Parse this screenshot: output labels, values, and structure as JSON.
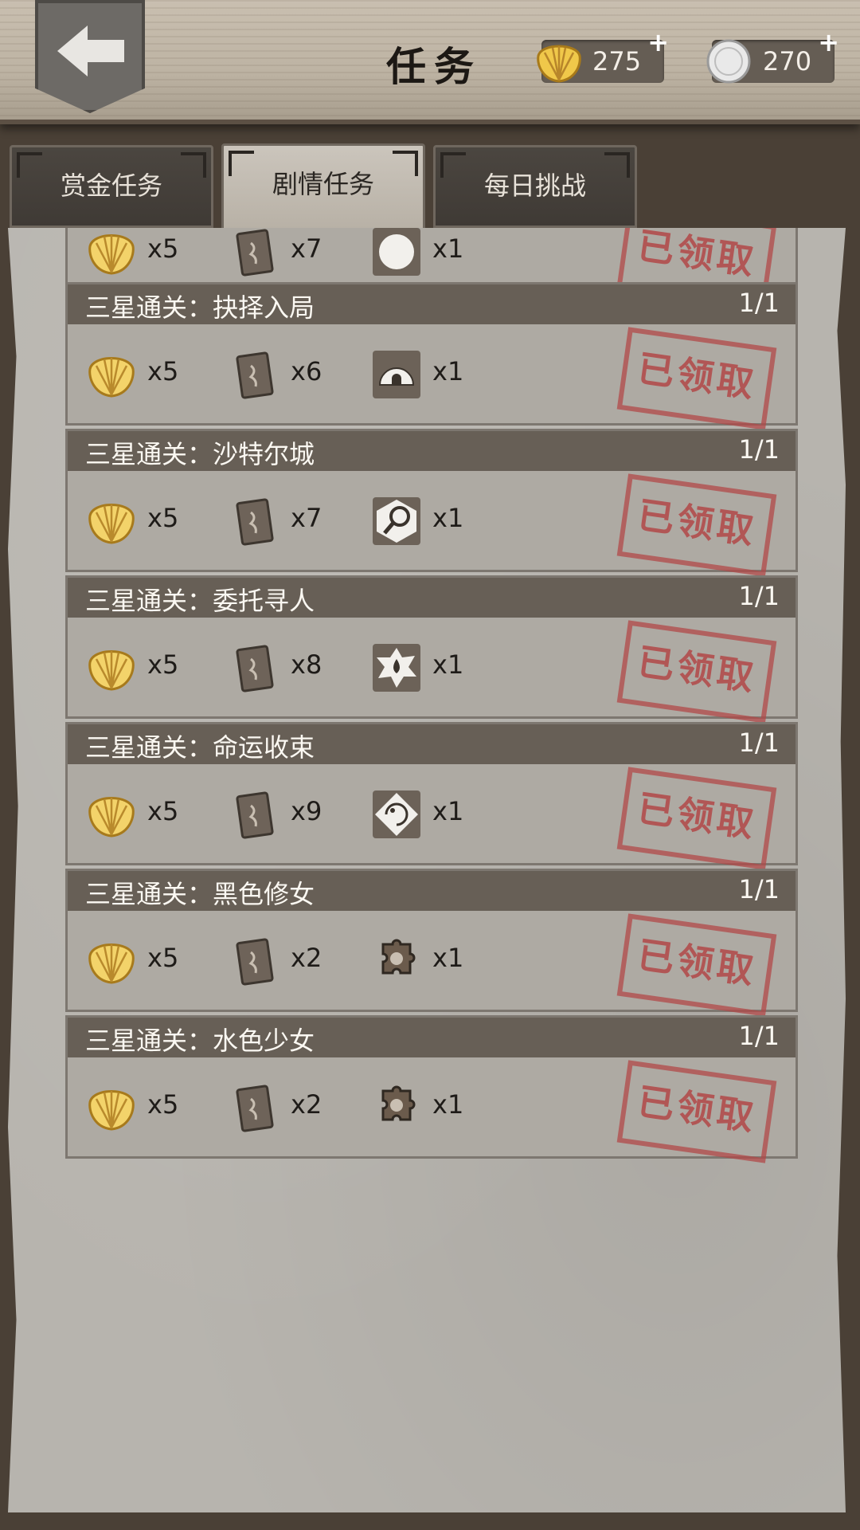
{
  "header": {
    "title": "任务",
    "currencies": [
      {
        "icon": "shell-icon",
        "value": "275",
        "plus": "+"
      },
      {
        "icon": "coin-icon",
        "value": "270",
        "plus": "+"
      }
    ]
  },
  "tabs": [
    {
      "label": "赏金任务",
      "active": false
    },
    {
      "label": "剧情任务",
      "active": true
    },
    {
      "label": "每日挑战",
      "active": false
    }
  ],
  "stamp_text": "已领取",
  "quests": [
    {
      "title": "",
      "progress": "",
      "rewards": [
        {
          "icon": "shell-icon",
          "qty": "x5"
        },
        {
          "icon": "book-icon",
          "qty": "x7"
        },
        {
          "icon": "item-icon",
          "qty": "x1"
        }
      ]
    },
    {
      "title": "三星通关：抉择入局",
      "progress": "1/1",
      "rewards": [
        {
          "icon": "shell-icon",
          "qty": "x5"
        },
        {
          "icon": "book-icon",
          "qty": "x6"
        },
        {
          "icon": "igloo-icon",
          "qty": "x1"
        }
      ]
    },
    {
      "title": "三星通关：沙特尔城",
      "progress": "1/1",
      "rewards": [
        {
          "icon": "shell-icon",
          "qty": "x5"
        },
        {
          "icon": "book-icon",
          "qty": "x7"
        },
        {
          "icon": "magnifier-icon",
          "qty": "x1"
        }
      ]
    },
    {
      "title": "三星通关：委托寻人",
      "progress": "1/1",
      "rewards": [
        {
          "icon": "shell-icon",
          "qty": "x5"
        },
        {
          "icon": "book-icon",
          "qty": "x8"
        },
        {
          "icon": "drop-icon",
          "qty": "x1"
        }
      ]
    },
    {
      "title": "三星通关：命运收束",
      "progress": "1/1",
      "rewards": [
        {
          "icon": "shell-icon",
          "qty": "x5"
        },
        {
          "icon": "book-icon",
          "qty": "x9"
        },
        {
          "icon": "face-icon",
          "qty": "x1"
        }
      ]
    },
    {
      "title": "三星通关：黑色修女",
      "progress": "1/1",
      "rewards": [
        {
          "icon": "shell-icon",
          "qty": "x5"
        },
        {
          "icon": "book-icon",
          "qty": "x2"
        },
        {
          "icon": "puzzle-icon",
          "qty": "x1"
        }
      ]
    },
    {
      "title": "三星通关：水色少女",
      "progress": "1/1",
      "rewards": [
        {
          "icon": "shell-icon",
          "qty": "x5"
        },
        {
          "icon": "book-icon",
          "qty": "x2"
        },
        {
          "icon": "puzzle-icon",
          "qty": "x1"
        }
      ]
    }
  ]
}
